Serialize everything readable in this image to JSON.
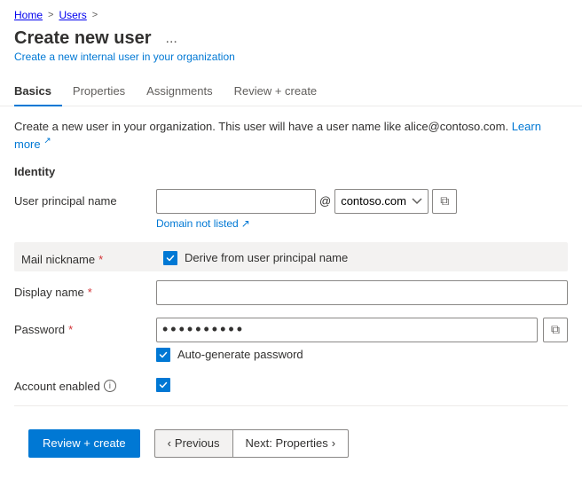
{
  "breadcrumb": {
    "home": "Home",
    "separator1": ">",
    "users": "Users",
    "separator2": ">"
  },
  "header": {
    "title": "Create new user",
    "ellipsis": "...",
    "subtitle": "Create a new internal user in your organization"
  },
  "tabs": [
    {
      "id": "basics",
      "label": "Basics",
      "active": true
    },
    {
      "id": "properties",
      "label": "Properties",
      "active": false
    },
    {
      "id": "assignments",
      "label": "Assignments",
      "active": false
    },
    {
      "id": "review-create",
      "label": "Review + create",
      "active": false
    }
  ],
  "info_text": "Create a new user in your organization. This user will have a user name like alice@contoso.com.",
  "learn_more": "Learn more",
  "section_title": "Identity",
  "form": {
    "user_principal_name": {
      "label": "User principal name",
      "input_value": "",
      "input_placeholder": "",
      "at_sign": "@",
      "domain_value": "contoso.com",
      "domain_options": [
        "contoso.com"
      ],
      "domain_not_listed": "Domain not listed",
      "copy_tooltip": "Copy"
    },
    "mail_nickname": {
      "label": "Mail nickname",
      "required": true,
      "derive_checkbox": true,
      "derive_label": "Derive from user principal name"
    },
    "display_name": {
      "label": "Display name",
      "required": true,
      "value": ""
    },
    "password": {
      "label": "Password",
      "required": true,
      "value": "••••••••••",
      "placeholder": "••••••••••",
      "auto_generate_checkbox": true,
      "auto_generate_label": "Auto-generate password",
      "copy_tooltip": "Copy"
    },
    "account_enabled": {
      "label": "Account enabled",
      "checked": true,
      "info": true
    }
  },
  "footer": {
    "review_create_btn": "Review + create",
    "previous_btn": "Previous",
    "next_btn": "Next: Properties",
    "next_arrow": "›",
    "prev_arrow": "‹"
  },
  "icons": {
    "chevron_left": "‹",
    "chevron_right": "›",
    "check": "✓",
    "external_link": "↗",
    "copy": "⧉",
    "info": "i"
  }
}
